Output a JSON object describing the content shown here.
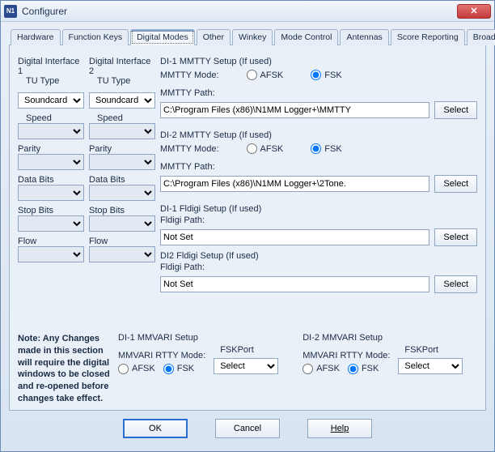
{
  "titlebar": {
    "title": "Configurer",
    "close_glyph": "✕"
  },
  "tabs": {
    "hardware": "Hardware",
    "function_keys": "Function Keys",
    "digital_modes": "Digital Modes",
    "other": "Other",
    "winkey": "Winkey",
    "mode_control": "Mode Control",
    "antennas": "Antennas",
    "score_reporting": "Score Reporting",
    "broadcast_data": "Broadcast Data"
  },
  "di1": {
    "header": "Digital Interface 1",
    "tu_type": "TU Type",
    "tu_value": "Soundcard",
    "speed": "Speed",
    "speed_value": "",
    "parity": "Parity",
    "parity_value": "",
    "data_bits": "Data Bits",
    "data_bits_value": "",
    "stop_bits": "Stop Bits",
    "stop_bits_value": "",
    "flow": "Flow",
    "flow_value": ""
  },
  "di2": {
    "header": "Digital Interface 2",
    "tu_type": "TU Type",
    "tu_value": "Soundcard",
    "speed": "Speed",
    "speed_value": "",
    "parity": "Parity",
    "parity_value": "",
    "data_bits": "Data Bits",
    "data_bits_value": "",
    "stop_bits": "Stop Bits",
    "stop_bits_value": "",
    "flow": "Flow",
    "flow_value": ""
  },
  "mmtty1": {
    "title": "DI-1 MMTTY Setup (If used)",
    "mode_label": "MMTTY Mode:",
    "afsk": "AFSK",
    "fsk": "FSK",
    "path_label": "MMTTY Path:",
    "path_value": "C:\\Program Files (x86)\\N1MM Logger+\\MMTTY",
    "select": "Select"
  },
  "mmtty2": {
    "title": "DI-2 MMTTY Setup (If used)",
    "mode_label": "MMTTY Mode:",
    "afsk": "AFSK",
    "fsk": "FSK",
    "path_label": "MMTTY Path:",
    "path_value": "C:\\Program Files (x86)\\N1MM Logger+\\2Tone.",
    "select": "Select"
  },
  "fldigi1": {
    "title": "DI-1 Fldigi Setup (If used)",
    "path_label": "Fldigi Path:",
    "path_value": "Not Set",
    "select": "Select"
  },
  "fldigi2": {
    "title": "DI2 Fldigi Setup (If used)",
    "path_label": "Fldigi Path:",
    "path_value": "Not Set",
    "select": "Select"
  },
  "mmvari1": {
    "title": "DI-1 MMVARI Setup",
    "mode_label": "MMVARI RTTY Mode:",
    "afsk": "AFSK",
    "fsk": "FSK",
    "fskport": "FSKPort",
    "fskport_value": "Select"
  },
  "mmvari2": {
    "title": "DI-2 MMVARI Setup",
    "mode_label": "MMVARI RTTY Mode:",
    "afsk": "AFSK",
    "fsk": "FSK",
    "fskport": "FSKPort",
    "fskport_value": "Select"
  },
  "note": "Note: Any Changes made in this section will require the digital windows to be closed and re-opened before changes take effect.",
  "footer": {
    "ok": "OK",
    "cancel": "Cancel",
    "help": "Help"
  }
}
